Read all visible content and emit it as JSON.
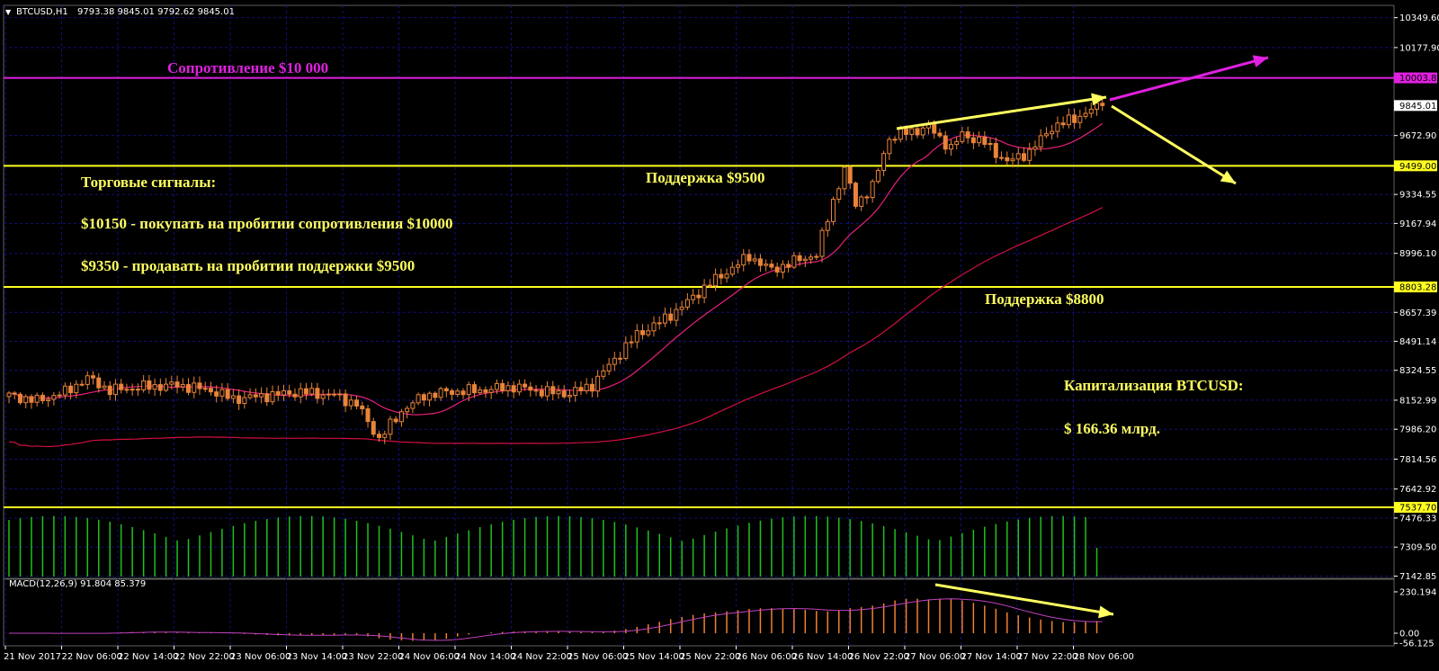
{
  "header": {
    "symbol": "BTCUSD,H1",
    "ohlc": "9793.38 9845.01 9792.62 9845.01"
  },
  "macd_label": "MACD(12,26,9) 91.804 85.379",
  "annotations": {
    "resistance": "Сопротивление $10 000",
    "support_9500": "Поддержка $9500",
    "support_8800": "Поддержка $8800",
    "signals_title": "Торговые сигналы:",
    "signal_buy": "$10150 - покупать на пробитии сопротивления $10000",
    "signal_sell": "$9350 - продавать на пробитии поддержки $9500",
    "cap_title": "Капитализация BTCUSD:",
    "cap_value": "$ 166.36 млрд."
  },
  "colors": {
    "background": "#000000",
    "grid": "#10107a",
    "candle": "#e8843a",
    "resistance": "#e020e0",
    "support": "#ffff20",
    "fast_ma": "#e8207a",
    "slow_ma": "#d01040",
    "volume": "#20c020",
    "macd_hist": "#f08030",
    "signal_line": "#c040c0"
  },
  "chart_data": {
    "type": "candlestick",
    "symbol": "BTCUSD",
    "timeframe": "H1",
    "price_ticks": [
      10349.6,
      10177.9,
      10003.86,
      9845.01,
      9672.9,
      9499.0,
      9334.55,
      9167.94,
      8996.1,
      8803.28,
      8657.39,
      8491.14,
      8324.55,
      8152.99,
      7986.2,
      7814.56,
      7642.92,
      7537.7,
      7476.33,
      7309.5,
      7142.85
    ],
    "price_badges": [
      10003.86,
      9845.01,
      9499.0,
      8803.28,
      7537.7
    ],
    "ylim": [
      7130,
      10420
    ],
    "macd_ticks": [
      230.194,
      0.0,
      -56.125
    ],
    "macd_ylim": [
      -70,
      270
    ],
    "x_ticks": [
      "21 Nov 2017",
      "22 Nov 06:00",
      "22 Nov 14:00",
      "22 Nov 22:00",
      "23 Nov 06:00",
      "23 Nov 14:00",
      "23 Nov 22:00",
      "24 Nov 06:00",
      "24 Nov 14:00",
      "24 Nov 22:00",
      "25 Nov 06:00",
      "25 Nov 14:00",
      "25 Nov 22:00",
      "26 Nov 06:00",
      "26 Nov 14:00",
      "26 Nov 22:00",
      "27 Nov 06:00",
      "27 Nov 14:00",
      "27 Nov 22:00",
      "28 Nov 06:00"
    ],
    "levels": {
      "resistance": 10003.86,
      "support_upper": 9499.0,
      "support_lower": 8803.28,
      "support_bottom": 7537.7
    },
    "close_anchors": [
      [
        0,
        8180
      ],
      [
        5,
        8150
      ],
      [
        10,
        8200
      ],
      [
        14,
        8280
      ],
      [
        18,
        8210
      ],
      [
        24,
        8230
      ],
      [
        30,
        8240
      ],
      [
        36,
        8210
      ],
      [
        40,
        8160
      ],
      [
        46,
        8180
      ],
      [
        52,
        8200
      ],
      [
        58,
        8180
      ],
      [
        62,
        8130
      ],
      [
        66,
        7930
      ],
      [
        70,
        8090
      ],
      [
        74,
        8180
      ],
      [
        78,
        8200
      ],
      [
        84,
        8210
      ],
      [
        90,
        8230
      ],
      [
        96,
        8200
      ],
      [
        100,
        8190
      ],
      [
        104,
        8240
      ],
      [
        108,
        8390
      ],
      [
        112,
        8530
      ],
      [
        116,
        8600
      ],
      [
        120,
        8690
      ],
      [
        124,
        8800
      ],
      [
        128,
        8890
      ],
      [
        132,
        8980
      ],
      [
        136,
        8900
      ],
      [
        140,
        8950
      ],
      [
        144,
        8990
      ],
      [
        147,
        9300
      ],
      [
        149,
        9480
      ],
      [
        151,
        9280
      ],
      [
        154,
        9380
      ],
      [
        157,
        9660
      ],
      [
        160,
        9690
      ],
      [
        164,
        9720
      ],
      [
        168,
        9600
      ],
      [
        170,
        9680
      ],
      [
        174,
        9630
      ],
      [
        178,
        9520
      ],
      [
        182,
        9580
      ],
      [
        186,
        9720
      ],
      [
        190,
        9770
      ],
      [
        193,
        9820
      ],
      [
        195,
        9845
      ]
    ]
  }
}
